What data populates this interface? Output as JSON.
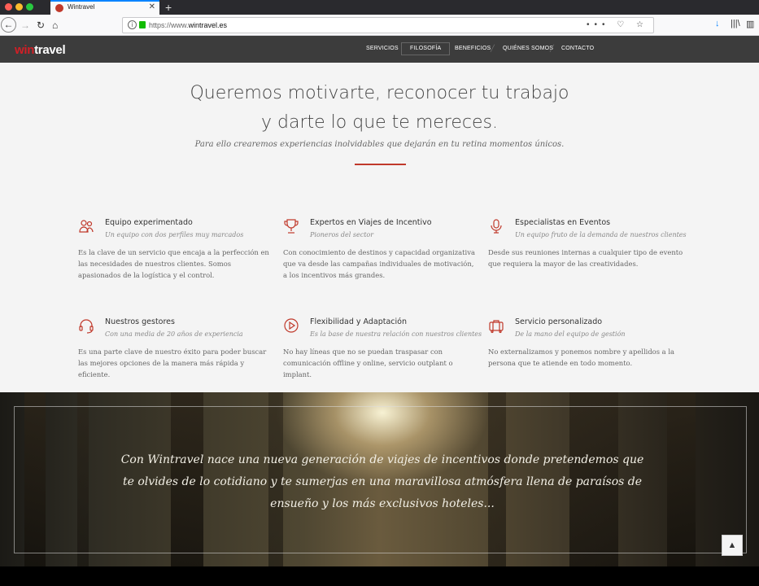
{
  "browser": {
    "tab_title": "Wintravel",
    "tab_close": "✕",
    "new_tab": "+",
    "url_prefix": "https://www.",
    "url_domain": "wintravel.es",
    "url_actions": "••• ♡ ☆",
    "back": "←",
    "forward": "→",
    "reload": "↻",
    "home": "⌂",
    "download_icon": "↓",
    "library_icon": "|||\\",
    "sidebar_icon": "▥"
  },
  "site": {
    "logo_prefix": "win",
    "logo_suffix": "travel",
    "menu": [
      "SERVICIOS",
      "FILOSOFÍA",
      "BENEFICIOS",
      "QUIÉNES SOMOS",
      "CONTACTO"
    ],
    "active_menu": "FILOSOFÍA",
    "accent_color": "#c0392b"
  },
  "intro": {
    "headline_line1": "Queremos motivarte, reconocer tu trabajo",
    "headline_line2": "y darte lo que te mereces.",
    "subhead": "Para ello crearemos experiencias inolvidables que dejarán en tu retina momentos únicos."
  },
  "features": [
    {
      "icon": "team-icon",
      "title": "Equipo experimentado",
      "subtitle": "Un equipo con dos perfiles muy marcados",
      "text": "Es la clave de un servicio que encaja a la perfección en las necesidades de nuestros clientes. Somos apasionados de la logística y el control."
    },
    {
      "icon": "trophy-icon",
      "title": "Expertos en Viajes de Incentivo",
      "subtitle": "Pioneros del sector",
      "text": "Con conocimiento de destinos y capacidad organizativa que va desde las campañas individuales de motivación, a los incentivos más grandes."
    },
    {
      "icon": "microphone-icon",
      "title": "Especialistas en Eventos",
      "subtitle": "Un equipo fruto de la demanda de nuestros clientes",
      "text": "Desde sus reuniones internas a cualquier tipo de evento que requiera la mayor de las creatividades."
    },
    {
      "icon": "headset-icon",
      "title": "Nuestros gestores",
      "subtitle": "Con una media de 20 años de experiencia",
      "text": "Es una parte clave de nuestro éxito para poder buscar las mejores opciones de la manera más rápida y eficiente."
    },
    {
      "icon": "play-icon",
      "title": "Flexibilidad y Adaptación",
      "subtitle": "Es la base de nuestra relación con nuestros clientes",
      "text": "No hay líneas que no se puedan traspasar con comunicación offline y online, servicio outplant o implant."
    },
    {
      "icon": "luggage-icon",
      "title": "Servicio personalizado",
      "subtitle": "De la mano del equipo de gestión",
      "text": "No externalizamos y ponemos nombre y apellidos a la persona que te atiende en todo momento."
    }
  ],
  "hero": {
    "quote": "Con Wintravel nace una nueva generación de viajes de incentivos donde pretendemos que te olvides de lo cotidiano y te sumerjas en una maravillosa atmósfera llena de paraísos de ensueño y los más exclusivos hoteles..."
  },
  "scroll_top": "▲"
}
